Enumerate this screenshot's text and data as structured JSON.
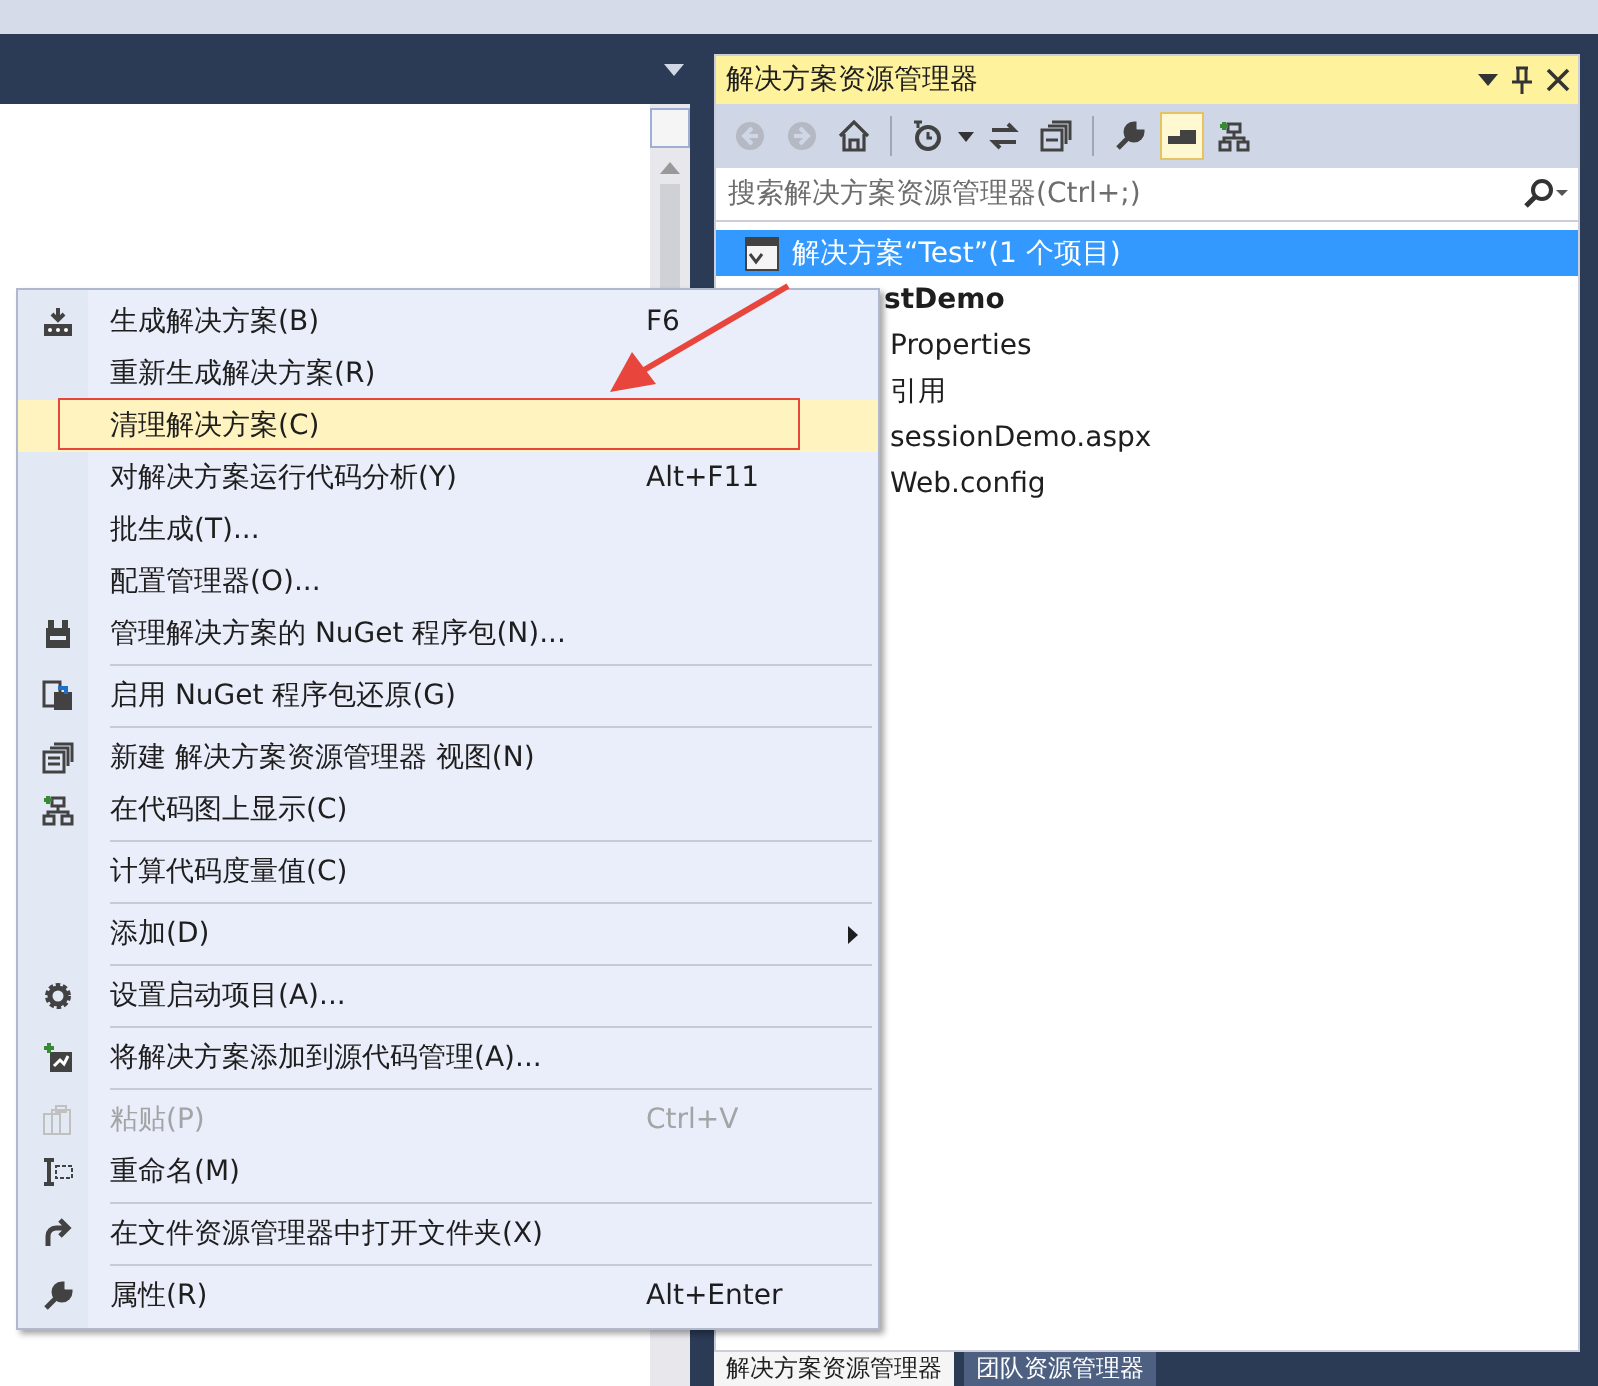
{
  "solution_explorer": {
    "title": "解决方案资源管理器",
    "toolbar": [
      {
        "disabled": true,
        "selected": false
      },
      {
        "disabled": true,
        "selected": false
      },
      {
        "disabled": false,
        "selected": false
      },
      {
        "disabled": false,
        "selected": false
      },
      {
        "disabled": false,
        "selected": false
      },
      {
        "disabled": false,
        "selected": false
      },
      {
        "disabled": false,
        "selected": false
      },
      {
        "disabled": false,
        "selected": true
      },
      {
        "disabled": false,
        "selected": false
      }
    ],
    "search": {
      "placeholder": "搜索解决方案资源管理器(Ctrl+;)"
    },
    "tree": [
      {
        "label": "解决方案“Test”(1 个项目)",
        "selected": true,
        "bold": false,
        "children": [
          {
            "label": "stDemo",
            "selected": false,
            "bold": true,
            "children": [
              {
                "label": "Properties",
                "selected": false,
                "bold": false
              },
              {
                "label": "引用",
                "selected": false,
                "bold": false
              },
              {
                "label": "sessionDemo.aspx",
                "selected": false,
                "bold": false
              },
              {
                "label": "Web.config",
                "selected": false,
                "bold": false
              }
            ]
          }
        ]
      }
    ]
  },
  "bottom_tabs": [
    {
      "label": "解决方案资源管理器",
      "selected": true
    },
    {
      "label": "团队资源管理器",
      "selected": false
    }
  ],
  "context_menu": {
    "groups": [
      [
        {
          "label": "生成解决方案(B)",
          "shortcut": "F6",
          "selected": false,
          "disabled": false,
          "submenu": false
        },
        {
          "label": "重新生成解决方案(R)",
          "selected": false,
          "disabled": false,
          "submenu": false
        },
        {
          "label": "清理解决方案(C)",
          "selected": true,
          "disabled": false,
          "submenu": false,
          "framed": true
        },
        {
          "label": "对解决方案运行代码分析(Y)",
          "shortcut": "Alt+F11",
          "selected": false,
          "disabled": false,
          "submenu": false
        },
        {
          "label": "批生成(T)...",
          "selected": false,
          "disabled": false,
          "submenu": false
        },
        {
          "label": "配置管理器(O)...",
          "selected": false,
          "disabled": false,
          "submenu": false
        },
        {
          "label": "管理解决方案的 NuGet 程序包(N)...",
          "selected": false,
          "disabled": false,
          "submenu": false
        }
      ],
      [
        {
          "label": "启用 NuGet 程序包还原(G)",
          "selected": false,
          "disabled": false,
          "submenu": false
        }
      ],
      [
        {
          "label": "新建 解决方案资源管理器 视图(N)",
          "selected": false,
          "disabled": false,
          "submenu": false
        },
        {
          "label": "在代码图上显示(C)",
          "selected": false,
          "disabled": false,
          "submenu": false
        }
      ],
      [
        {
          "label": "计算代码度量值(C)",
          "selected": false,
          "disabled": false,
          "submenu": false
        }
      ],
      [
        {
          "label": "添加(D)",
          "selected": false,
          "disabled": false,
          "submenu": true
        }
      ],
      [
        {
          "label": "设置启动项目(A)...",
          "selected": false,
          "disabled": false,
          "submenu": false
        }
      ],
      [
        {
          "label": "将解决方案添加到源代码管理(A)...",
          "selected": false,
          "disabled": false,
          "submenu": false
        }
      ],
      [
        {
          "label": "粘贴(P)",
          "shortcut": "Ctrl+V",
          "selected": false,
          "disabled": true,
          "submenu": false
        },
        {
          "label": "重命名(M)",
          "selected": false,
          "disabled": false,
          "submenu": false
        }
      ],
      [
        {
          "label": "在文件资源管理器中打开文件夹(X)",
          "selected": false,
          "disabled": false,
          "submenu": false
        }
      ],
      [
        {
          "label": "属性(R)",
          "shortcut": "Alt+Enter",
          "selected": false,
          "disabled": false,
          "submenu": false
        }
      ]
    ]
  },
  "annotation": {
    "kind": "arrow"
  }
}
